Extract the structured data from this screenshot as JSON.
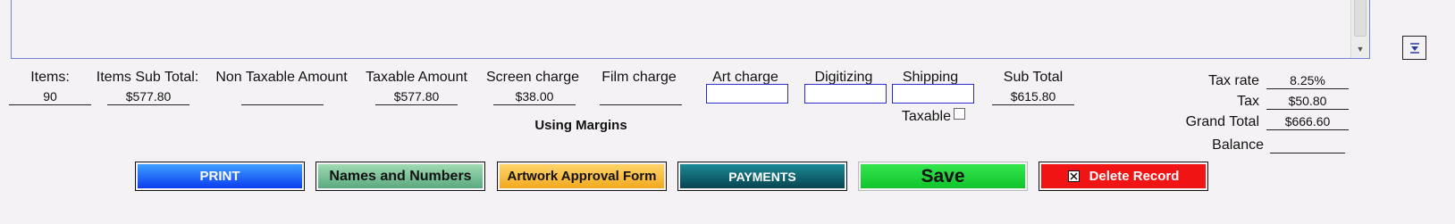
{
  "fields": {
    "items": {
      "label": "Items:",
      "value": "90"
    },
    "items_subtotal": {
      "label": "Items Sub Total:",
      "value": "$577.80"
    },
    "non_taxable": {
      "label": "Non Taxable Amount",
      "value": ""
    },
    "taxable": {
      "label": "Taxable Amount",
      "value": "$577.80"
    },
    "screen_charge": {
      "label": "Screen charge",
      "value": "$38.00"
    },
    "film_charge": {
      "label": "Film charge",
      "value": ""
    },
    "art_charge": {
      "label": "Art charge",
      "value": ""
    },
    "digitizing": {
      "label": "Digitizing",
      "value": ""
    },
    "shipping": {
      "label": "Shipping",
      "value": ""
    },
    "sub_total": {
      "label": "Sub Total",
      "value": "$615.80"
    }
  },
  "taxable_label": "Taxable",
  "using_margins": "Using Margins",
  "totals": {
    "tax_rate": {
      "label": "Tax rate",
      "value": "8.25%"
    },
    "tax": {
      "label": "Tax",
      "value": "$50.80"
    },
    "grand_total": {
      "label": "Grand Total",
      "value": "$666.60"
    },
    "balance": {
      "label": "Balance",
      "value": ""
    }
  },
  "buttons": {
    "print": "PRINT",
    "names_numbers": "Names and Numbers",
    "artwork": "Artwork Approval Form",
    "payments": "PAYMENTS",
    "save": "Save",
    "delete": "Delete Record"
  },
  "colors": {
    "print": "#1a5cff",
    "names_numbers": "#7cc49a",
    "artwork": "#f7b940",
    "payments": "#0f5f6e",
    "save": "#1fd43a",
    "delete": "#f01414"
  }
}
